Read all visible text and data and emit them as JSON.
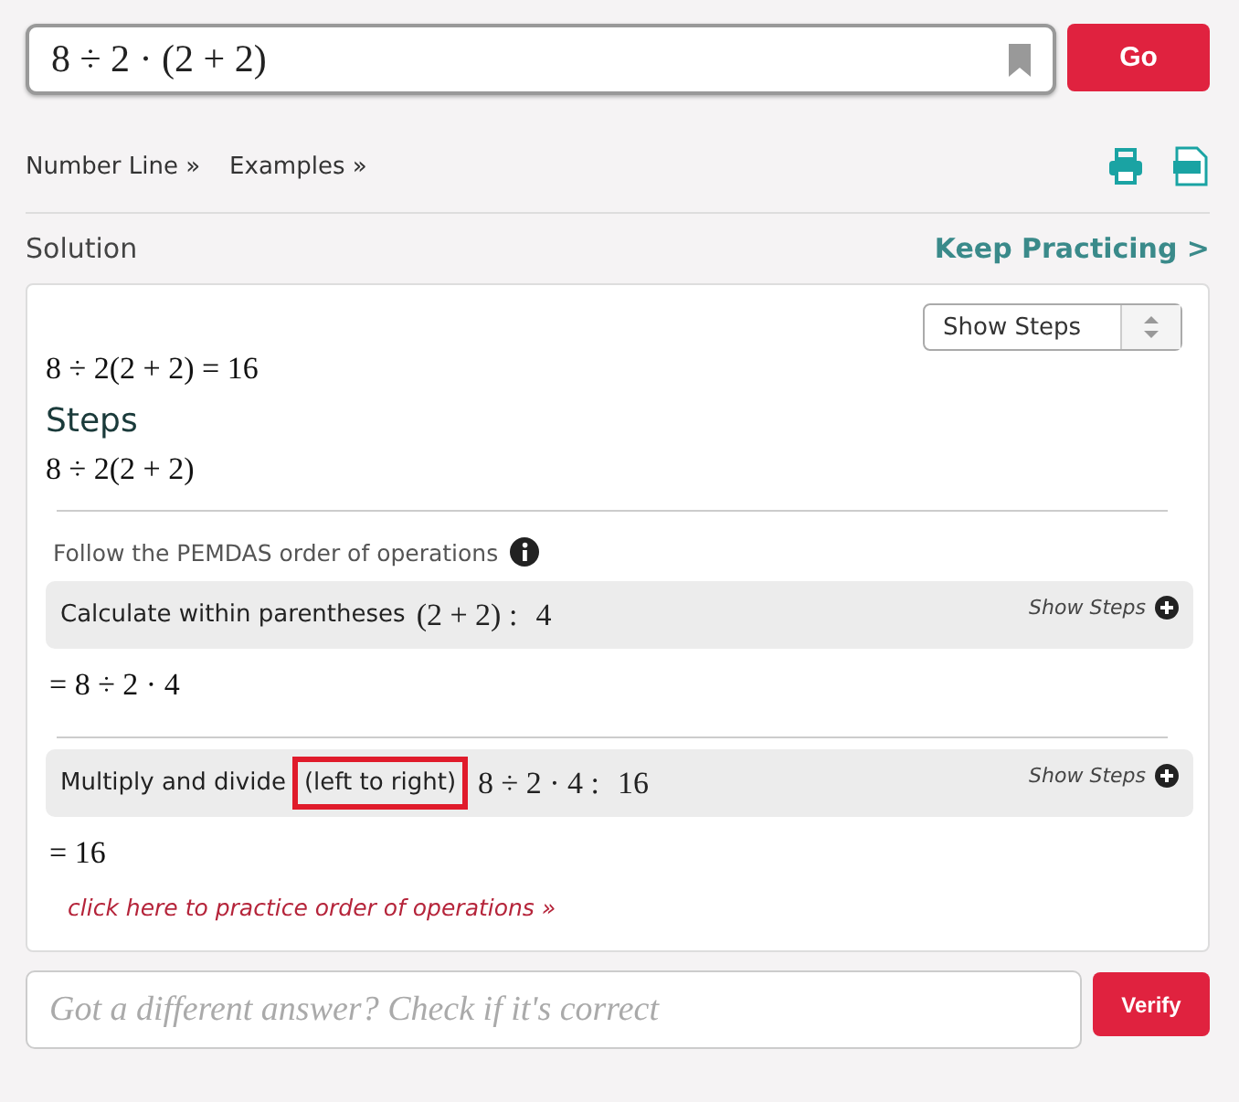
{
  "search": {
    "value": "8 ÷ 2 · (2 + 2)",
    "button": "Go"
  },
  "links": [
    "Number Line »",
    "Examples »"
  ],
  "solution": {
    "title": "Solution",
    "keep_practicing": "Keep Practicing >"
  },
  "card": {
    "show_steps_select": "Show Steps",
    "answer": "8 ÷ 2(2 + 2) = 16",
    "steps_title": "Steps",
    "problem": "8 ÷ 2(2 + 2)",
    "rule": "Follow the PEMDAS order of operations",
    "steps": [
      {
        "text": "Calculate within parentheses",
        "math": "(2 + 2) :",
        "value": "4",
        "show_steps": "Show Steps",
        "result": "= 8 ÷ 2 · 4"
      },
      {
        "text": "Multiply and divide",
        "highlight": "(left to right)",
        "math": "8 ÷ 2 · 4 :",
        "value": "16",
        "show_steps": "Show Steps",
        "result": "= 16"
      }
    ],
    "practice_link": "click here to practice order of operations »"
  },
  "verify": {
    "placeholder": "Got a different answer? Check if it's correct",
    "button": "Verify"
  }
}
